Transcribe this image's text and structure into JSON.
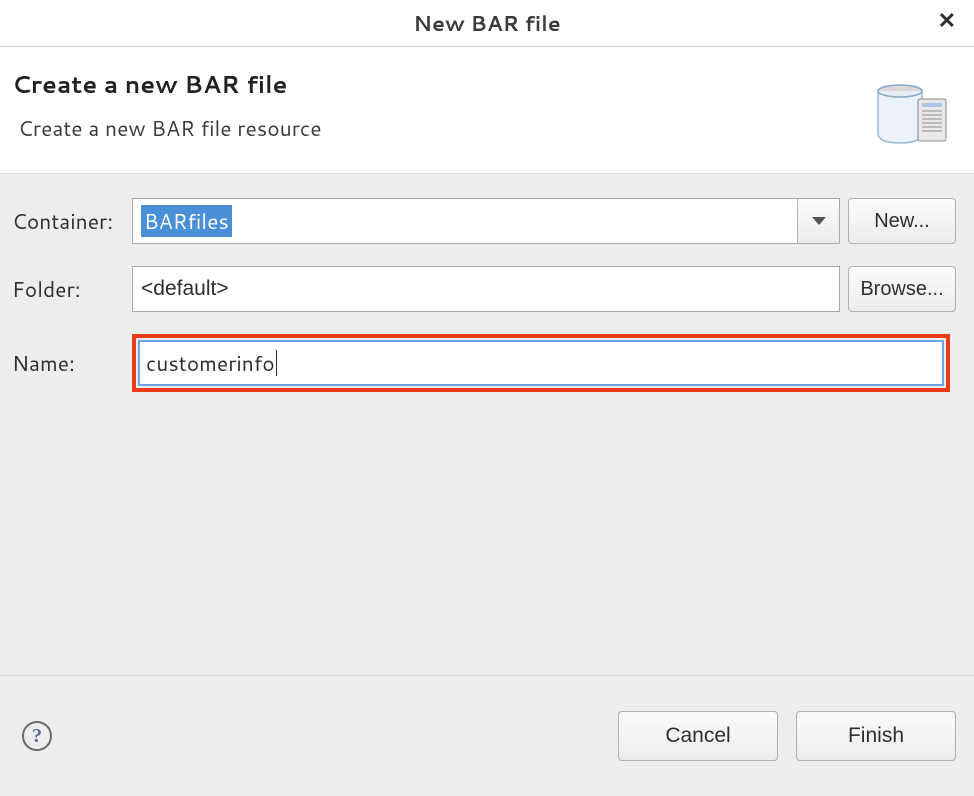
{
  "window": {
    "title": "New BAR file"
  },
  "banner": {
    "heading": "Create a new BAR file",
    "subtitle": "Create a new BAR file resource"
  },
  "form": {
    "container": {
      "label": "Container:",
      "value": "BARfiles",
      "new_button": "New..."
    },
    "folder": {
      "label": "Folder:",
      "value": "<default>",
      "browse_button": "Browse..."
    },
    "name": {
      "label": "Name:",
      "value": "customerinfo"
    }
  },
  "buttons": {
    "cancel": "Cancel",
    "finish": "Finish"
  },
  "icons": {
    "help": "?",
    "close": "✕"
  }
}
